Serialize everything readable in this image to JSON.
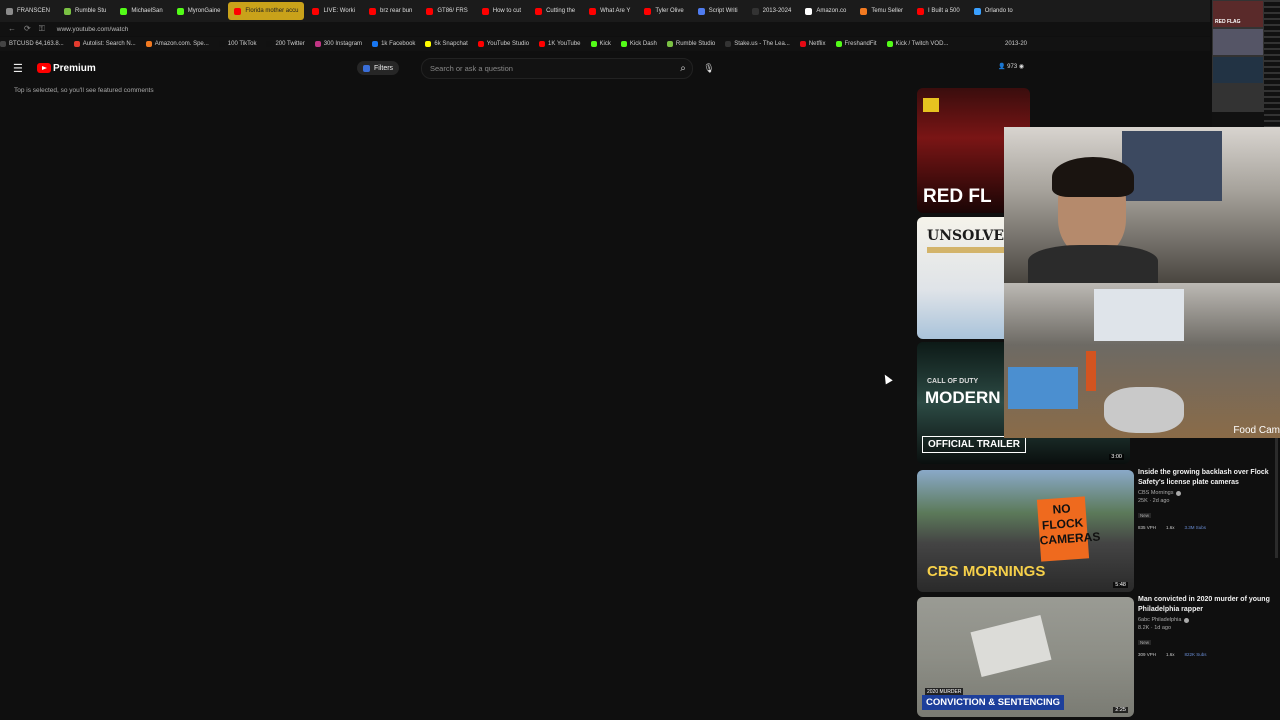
{
  "browser": {
    "tabs": [
      {
        "label": "FRANSCEN",
        "color": "#8b8b8b"
      },
      {
        "label": "Rumble Stu",
        "color": "#7ac143"
      },
      {
        "label": "MichaelSan",
        "color": "#53fc18"
      },
      {
        "label": "MyronGaine",
        "color": "#53fc18"
      },
      {
        "label": "Florida mother accu",
        "color": "#ff0000",
        "active": true
      },
      {
        "label": "LIVE: Worki",
        "color": "#ff0000"
      },
      {
        "label": "brz rear bun",
        "color": "#ff0000"
      },
      {
        "label": "GT86/ FRS",
        "color": "#ff0000"
      },
      {
        "label": "How to cut",
        "color": "#ff0000"
      },
      {
        "label": "Cutting the",
        "color": "#ff0000"
      },
      {
        "label": "What Are Y",
        "color": "#ff0000"
      },
      {
        "label": "Tyler Olive",
        "color": "#ff0000"
      },
      {
        "label": "Script Writi",
        "color": "#4f7cf0"
      },
      {
        "label": "2013-2024",
        "color": "#333333"
      },
      {
        "label": "Amazon.co",
        "color": "#ffffff"
      },
      {
        "label": "Temu Seller",
        "color": "#f27a21"
      },
      {
        "label": "I Built a 500",
        "color": "#ff0000"
      },
      {
        "label": "Orlando to",
        "color": "#3aa0ff"
      }
    ],
    "url": "www.youtube.com/watch",
    "bookmarks": [
      {
        "label": "BTCUSD 64,163.8...",
        "color": "#444444"
      },
      {
        "label": "Autolist: Search N...",
        "color": "#e33b2e"
      },
      {
        "label": "Amazon.com. Spe...",
        "color": "#f27a21"
      },
      {
        "label": "100 TikTok",
        "color": "#111111"
      },
      {
        "label": "200 Twitter",
        "color": "#111111"
      },
      {
        "label": "300 Instagram",
        "color": "#c13584"
      },
      {
        "label": "1k Facebook",
        "color": "#1877f2"
      },
      {
        "label": "6k Snapchat",
        "color": "#fffc00"
      },
      {
        "label": "YouTube Studio",
        "color": "#ff0000"
      },
      {
        "label": "1K YouTube",
        "color": "#ff0000"
      },
      {
        "label": "Kick",
        "color": "#53fc18"
      },
      {
        "label": "Kick Dash",
        "color": "#53fc18"
      },
      {
        "label": "Rumble Studio",
        "color": "#7ac143"
      },
      {
        "label": "Stake.us - The Lea...",
        "color": "#333333"
      },
      {
        "label": "Netflix",
        "color": "#e50914"
      },
      {
        "label": "FreshandFit",
        "color": "#53fc18"
      },
      {
        "label": "Kick / Twitch VOD...",
        "color": "#53fc18"
      }
    ],
    "bookmark_tail": "2013-20"
  },
  "youtube": {
    "logo_text": "Premium",
    "filters_label": "Filters",
    "search_placeholder": "Search or ask a question",
    "viewer_count": "973",
    "comments_note": "Top is selected, so you'll see featured comments"
  },
  "recommendations": [
    {
      "title": "Inside the growing backlash over Flock Safety's license plate cameras",
      "channel": "CBS Mornings",
      "stats": "25K · 2d ago",
      "badge": "New",
      "vph": "835 VPH",
      "mult": "1.6x",
      "subs": "3.3M Subs",
      "duration": "5:48",
      "thumb_text": "CBS MORNINGS",
      "sign_text": "NO FLOCK CAMERAS"
    },
    {
      "title": "Man convicted in 2020 murder of young Philadelphia rapper",
      "channel": "6abc Philadelphia",
      "stats": "8.2K · 1d ago",
      "badge": "New",
      "vph": "309 VPH",
      "mult": "1.6x",
      "subs": "822K Subs",
      "duration": "2:25",
      "thumb_tag": "2020 MURDER",
      "thumb_text": "CONVICTION & SENTENCING"
    }
  ],
  "partial_thumbs": {
    "first_text": "RED FL",
    "second_text": "UNSOLVED",
    "third_top": "CALL OF DUTY",
    "third_text": "MODERN WARFA",
    "third_banner": "OFFICIAL TRAILER",
    "third_duration": "3:00"
  },
  "overlays": {
    "food_cam_label": "Food Cam",
    "mini_label": "RED FLAG"
  }
}
